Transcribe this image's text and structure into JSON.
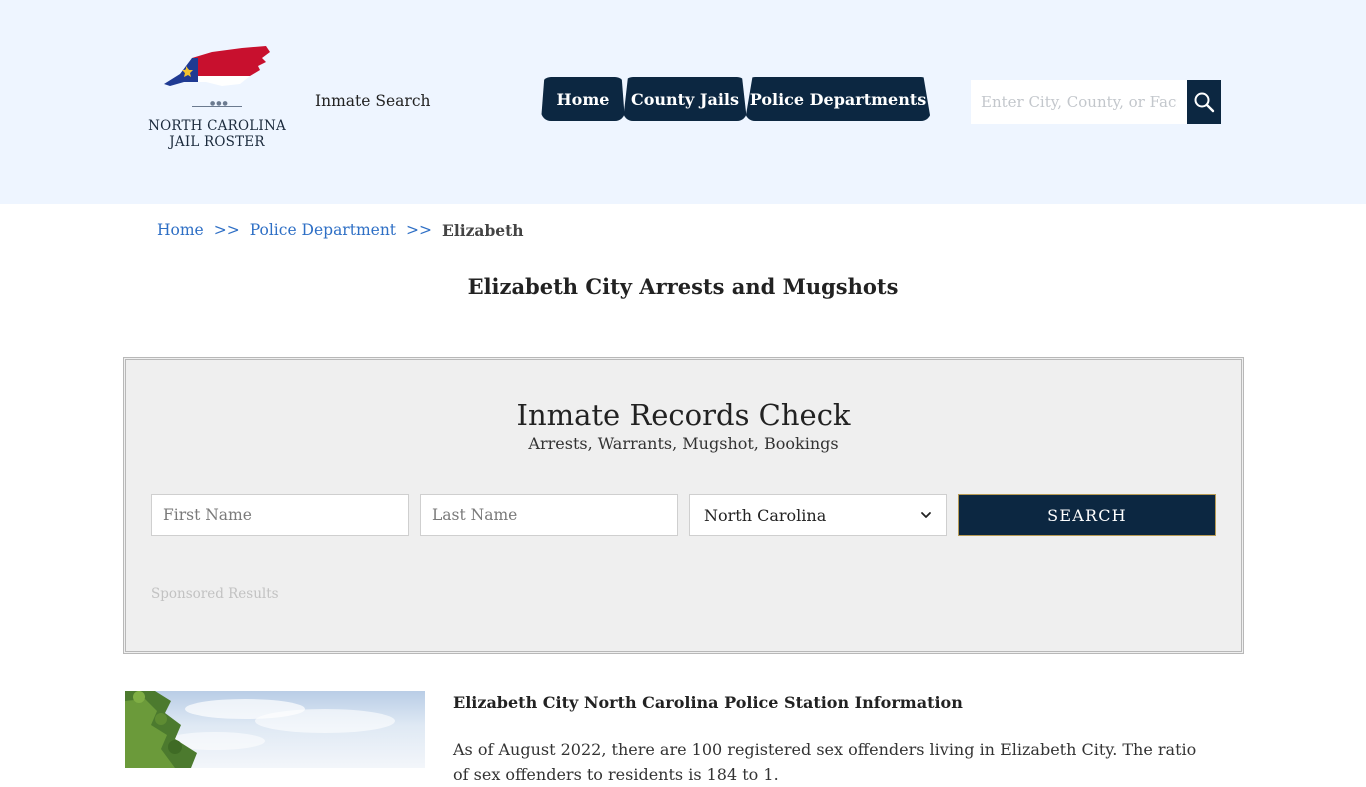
{
  "header": {
    "logo_line1": "NORTH CAROLINA",
    "logo_line2": "JAIL ROSTER",
    "inmate_search_label": "Inmate Search",
    "nav": [
      {
        "label": "Home"
      },
      {
        "label": "County Jails"
      },
      {
        "label": "Police Departments"
      }
    ],
    "search_placeholder": "Enter City, County, or Facility",
    "search_icon": "magnifier-icon"
  },
  "breadcrumb": {
    "home": "Home",
    "sep1": ">>",
    "police": "Police Department",
    "sep2": ">>",
    "current": "Elizabeth"
  },
  "page_title": "Elizabeth City Arrests and Mugshots",
  "records": {
    "title": "Inmate Records Check",
    "subtitle": "Arrests, Warrants, Mugshot, Bookings",
    "first_name_placeholder": "First Name",
    "last_name_placeholder": "Last Name",
    "state_selected": "North Carolina",
    "search_label": "SEARCH",
    "sponsored": "Sponsored Results"
  },
  "station": {
    "heading": "Elizabeth City North Carolina Police Station Information",
    "text": "As of August 2022, there are 100 registered sex offenders living in Elizabeth City. The ratio of sex offenders to residents is 184 to 1."
  },
  "colors": {
    "header_bg": "#eef5ff",
    "navy": "#0c2741",
    "link": "#2e6fc5",
    "flag_red": "#c8102e",
    "flag_blue": "#1f3a93"
  }
}
